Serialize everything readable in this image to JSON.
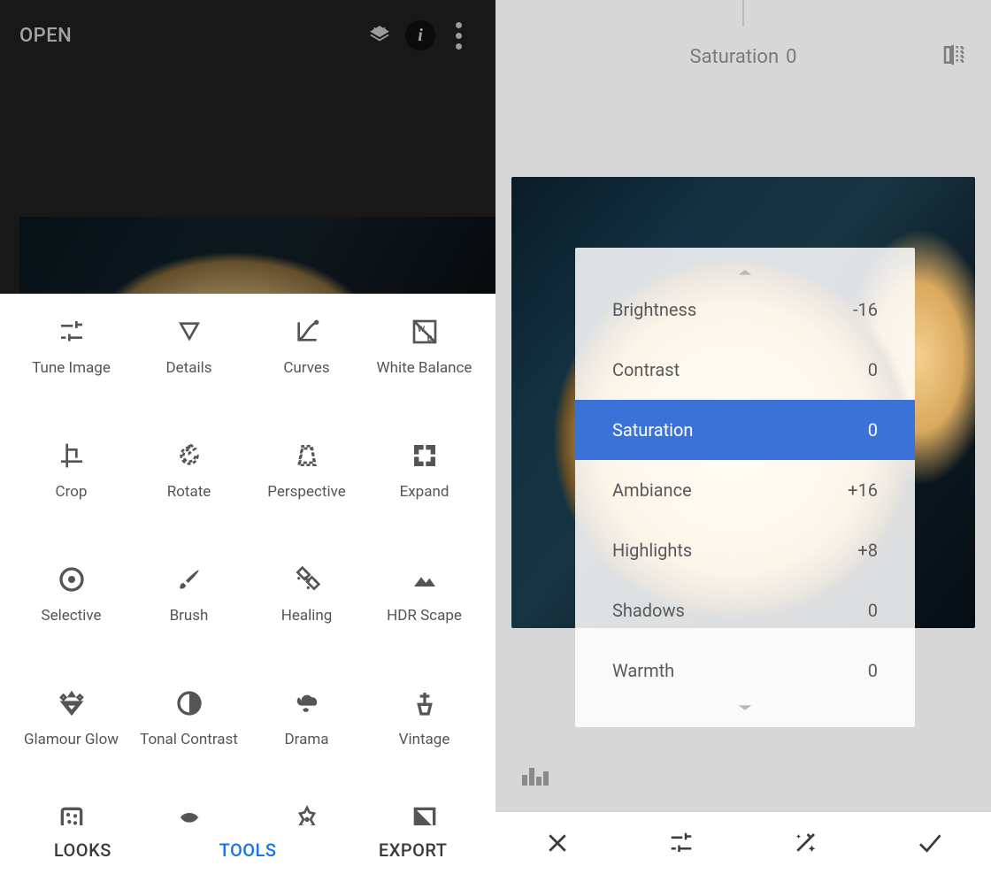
{
  "left": {
    "open_label": "OPEN",
    "tabs": {
      "looks": "LOOKS",
      "tools": "TOOLS",
      "export": "EXPORT",
      "active": "tools"
    },
    "header_icons": {
      "layers": "layers-icon",
      "info": "info-icon",
      "more": "more-icon"
    },
    "tools": [
      {
        "id": "tune-image",
        "label": "Tune Image"
      },
      {
        "id": "details",
        "label": "Details"
      },
      {
        "id": "curves",
        "label": "Curves"
      },
      {
        "id": "white-balance",
        "label": "White Balance"
      },
      {
        "id": "crop",
        "label": "Crop"
      },
      {
        "id": "rotate",
        "label": "Rotate"
      },
      {
        "id": "perspective",
        "label": "Perspective"
      },
      {
        "id": "expand",
        "label": "Expand"
      },
      {
        "id": "selective",
        "label": "Selective"
      },
      {
        "id": "brush",
        "label": "Brush"
      },
      {
        "id": "healing",
        "label": "Healing"
      },
      {
        "id": "hdr-scape",
        "label": "HDR Scape"
      },
      {
        "id": "glamour-glow",
        "label": "Glamour Glow"
      },
      {
        "id": "tonal-contrast",
        "label": "Tonal Contrast"
      },
      {
        "id": "drama",
        "label": "Drama"
      },
      {
        "id": "vintage",
        "label": "Vintage"
      },
      {
        "id": "grainy-film",
        "label": ""
      },
      {
        "id": "retrolux",
        "label": ""
      },
      {
        "id": "grunge",
        "label": ""
      },
      {
        "id": "bw",
        "label": ""
      }
    ]
  },
  "right": {
    "header": {
      "param": "Saturation",
      "value": "0"
    },
    "params": [
      {
        "name": "Brightness",
        "value": "-16",
        "selected": false
      },
      {
        "name": "Contrast",
        "value": "0",
        "selected": false
      },
      {
        "name": "Saturation",
        "value": "0",
        "selected": true
      },
      {
        "name": "Ambiance",
        "value": "+16",
        "selected": false
      },
      {
        "name": "Highlights",
        "value": "+8",
        "selected": false
      },
      {
        "name": "Shadows",
        "value": "0",
        "selected": false
      },
      {
        "name": "Warmth",
        "value": "0",
        "selected": false
      }
    ],
    "bottom_buttons": {
      "close": "close-icon",
      "adjust": "tune-icon",
      "auto": "magic-icon",
      "apply": "check-icon"
    }
  },
  "colors": {
    "accent_blue": "#1a73e8",
    "selection_blue": "#3a72d8"
  }
}
